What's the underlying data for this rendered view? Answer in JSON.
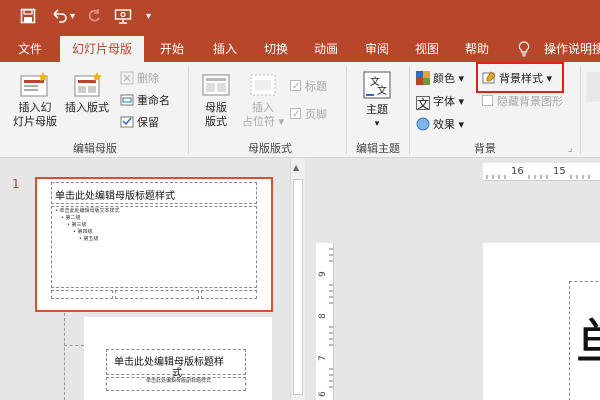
{
  "quick_access": {
    "icons": [
      "save-icon",
      "undo-icon",
      "redo-icon",
      "present-from-beginning-icon",
      "customize-qat-icon"
    ]
  },
  "tabs": [
    {
      "label": "文件",
      "active": false
    },
    {
      "label": "幻灯片母版",
      "active": true
    },
    {
      "label": "开始",
      "active": false
    },
    {
      "label": "插入",
      "active": false
    },
    {
      "label": "切换",
      "active": false
    },
    {
      "label": "动画",
      "active": false
    },
    {
      "label": "审阅",
      "active": false
    },
    {
      "label": "视图",
      "active": false
    },
    {
      "label": "帮助",
      "active": false
    }
  ],
  "tell_me": "操作说明搜",
  "ribbon": {
    "edit_master": {
      "insert_slide_master": "插入幻灯片母版",
      "insert_slide_master_line1": "插入幻",
      "insert_slide_master_line2": "灯片母版",
      "insert_layout": "插入版式",
      "delete": "删除",
      "rename": "重命名",
      "preserve": "保留",
      "group_label": "编辑母版"
    },
    "master_layout": {
      "master_layout_line1": "母版",
      "master_layout_line2": "版式",
      "insert_placeholder_line1": "插入",
      "insert_placeholder_line2": "占位符",
      "title_check": "标题",
      "footer_check": "页脚",
      "group_label": "母版版式"
    },
    "edit_theme": {
      "themes": "主题",
      "group_label": "编辑主题"
    },
    "background": {
      "colors": "颜色",
      "fonts": "字体",
      "effects": "效果",
      "background_styles": "背景样式",
      "hide_background_graphics": "隐藏背景图形",
      "group_label": "背景"
    }
  },
  "thumbnails": {
    "slide_number": "1",
    "master_title": "单击此处编辑母版标题样式",
    "master_body": [
      "• 单击此处编辑母版文本样式",
      "• 第二级",
      "• 第三级",
      "• 第四级",
      "• 第五级"
    ],
    "layout_title": "单击此处编辑母版标题样式",
    "layout_title_line1": "单击此处编辑母版标题样",
    "layout_title_line2": "式",
    "layout_subtitle": "单击此处编辑母版副标题样式"
  },
  "editor": {
    "ruler_h": "16",
    "ruler_h2": "15",
    "ruler_v": [
      "9",
      "8",
      "7",
      "6"
    ],
    "visible_char": "单"
  },
  "colors": {
    "accent": "#b7472a",
    "highlight_box": "#e0201b",
    "selected_thumb_border": "#d35230"
  }
}
